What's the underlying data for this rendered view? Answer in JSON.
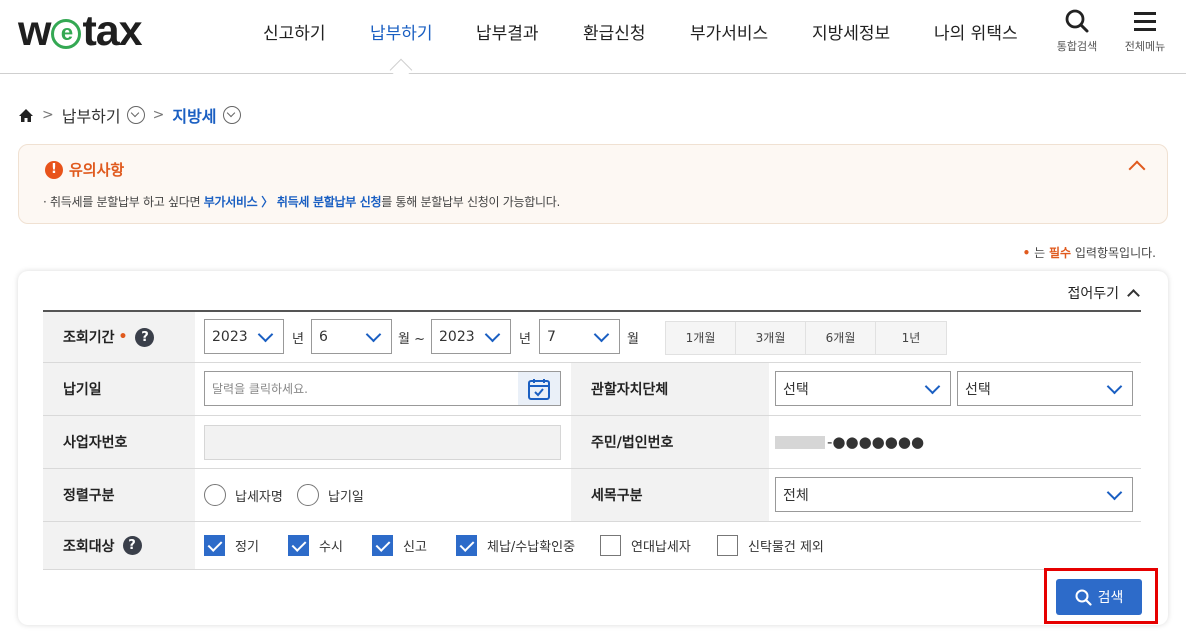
{
  "header": {
    "logo": "wetax",
    "nav": [
      "신고하기",
      "납부하기",
      "납부결과",
      "환급신청",
      "부가서비스",
      "지방세정보",
      "나의 위택스"
    ],
    "active_nav": "납부하기",
    "util_search": "통합검색",
    "util_menu": "전체메뉴"
  },
  "breadcrumb": {
    "level1": "납부하기",
    "level2": "지방세"
  },
  "notice": {
    "title": "유의사항",
    "text_prefix": "· 취득세를 분할납부 하고 싶다면 ",
    "link": "부가서비스 〉 취득세 분할납부 신청",
    "text_suffix": "를 통해 분할납부 신청이 가능합니다."
  },
  "required_note": {
    "dot": "•",
    "prefix": " 는 ",
    "req": "필수",
    "suffix": " 입력항목입니다."
  },
  "panel": {
    "fold_label": "접어두기",
    "period": {
      "label": "조회기간",
      "required_mark": "•",
      "start_year": "2023",
      "year_unit": "년",
      "start_month": "6",
      "month_unit_tilde": "월 ~",
      "end_year": "2023",
      "end_year_unit": "년",
      "end_month": "7",
      "end_month_unit": "월",
      "quick": [
        "1개월",
        "3개월",
        "6개월",
        "1년"
      ]
    },
    "pay_date": {
      "label": "납기일",
      "placeholder": "달력을 클릭하세요."
    },
    "jurisdiction": {
      "label": "관할자치단체",
      "select1": "선택",
      "select2": "선택"
    },
    "biz_no": {
      "label": "사업자번호"
    },
    "resident_no": {
      "label": "주민/법인번호",
      "masked": "-●●●●●●●"
    },
    "sort": {
      "label": "정렬구분",
      "options": [
        "납세자명",
        "납기일"
      ]
    },
    "tax_item": {
      "label": "세목구분",
      "value": "전체"
    },
    "target": {
      "label": "조회대상",
      "options": [
        {
          "label": "정기",
          "checked": true
        },
        {
          "label": "수시",
          "checked": true
        },
        {
          "label": "신고",
          "checked": true
        },
        {
          "label": "체납/수납확인중",
          "checked": true
        },
        {
          "label": "연대납세자",
          "checked": false
        },
        {
          "label": "신탁물건 제외",
          "checked": false
        }
      ]
    },
    "search_label": "검색"
  },
  "colors": {
    "accent": "#2d6bc9",
    "active_nav": "#1a5fc2",
    "notice": "#e05a1e",
    "highlight_box": "#e60000"
  }
}
